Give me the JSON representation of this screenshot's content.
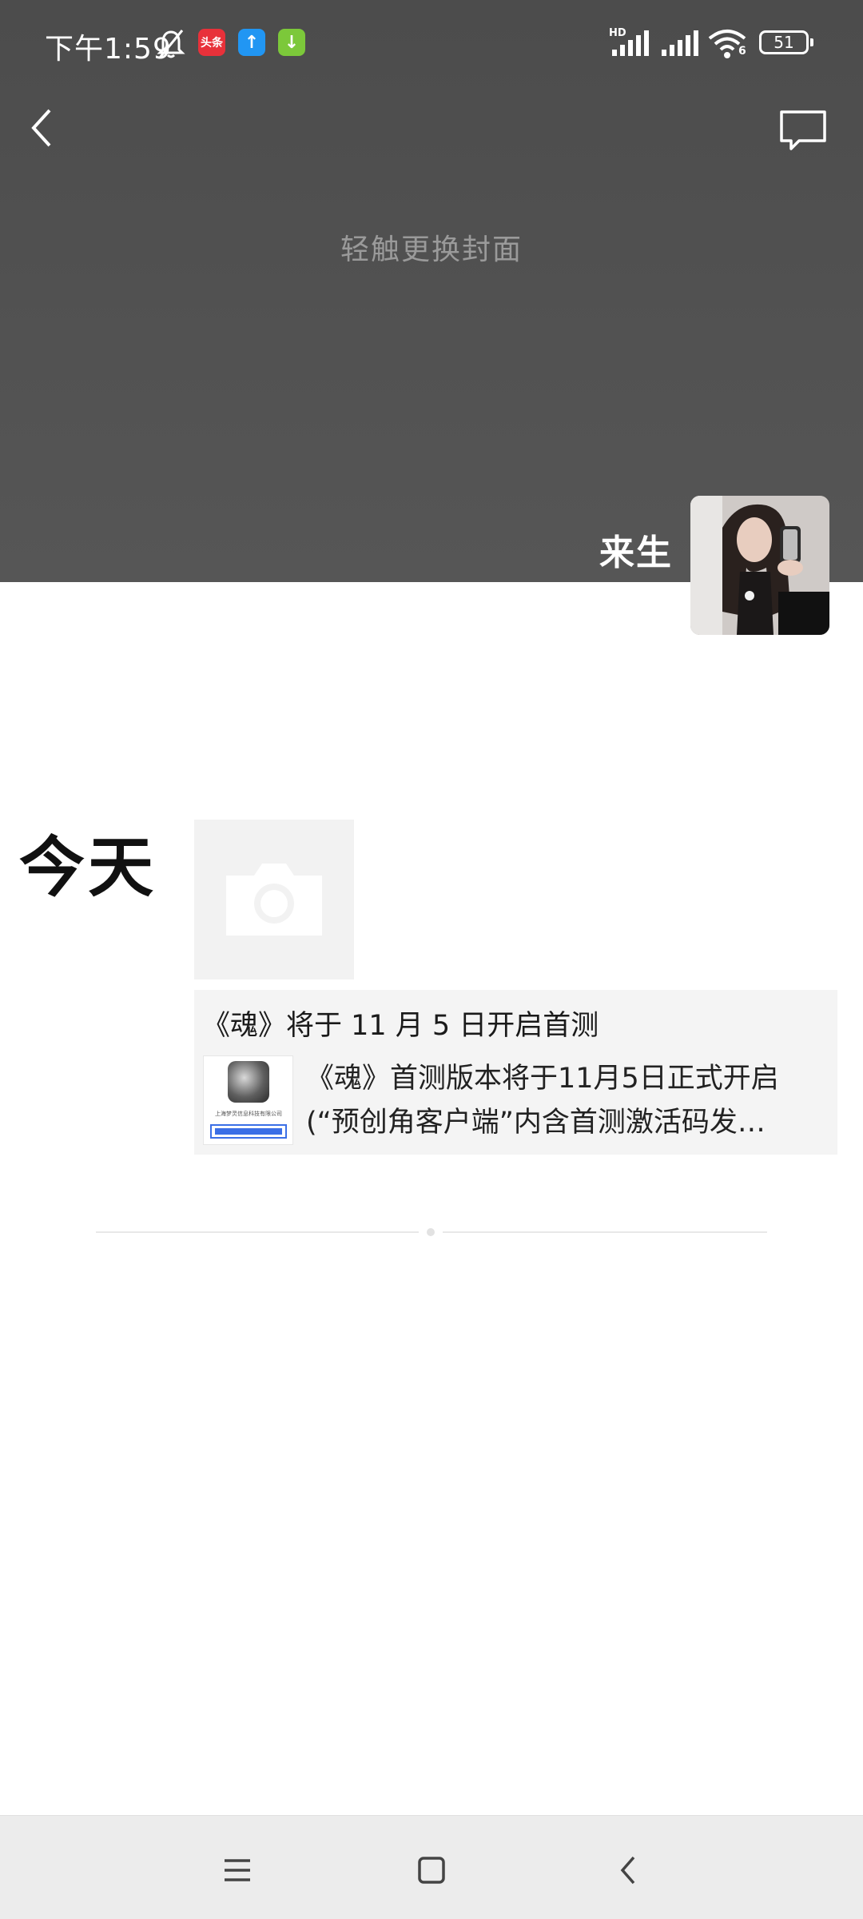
{
  "status_bar": {
    "time": "下午1:59",
    "app_badges": [
      {
        "name": "toutiao-app-icon",
        "label": "头条",
        "color": "#e8313a"
      },
      {
        "name": "upload-app-icon",
        "label": "↑",
        "color": "#2196f3"
      },
      {
        "name": "download-app-icon",
        "label": "↓",
        "color": "#7cc83a"
      }
    ],
    "network": "HD",
    "wifi_label": "6",
    "battery": "51"
  },
  "cover": {
    "hint": "轻触更换封面"
  },
  "profile": {
    "nickname": "来生"
  },
  "feed": {
    "day_label": "今天",
    "share": {
      "title": "《魂》将于 11 月 5 日开启首测",
      "desc_line1": "《魂》首测版本将于11月5日正式开启",
      "desc_line2": "(“预创角客户端”内含首测激活码发…",
      "thumb_caption": "上海梦灵信息科技有限公司"
    }
  },
  "colors": {
    "cover_bg": "#505050",
    "card_bg": "#f4f4f4",
    "nav_bg": "#ececec"
  }
}
